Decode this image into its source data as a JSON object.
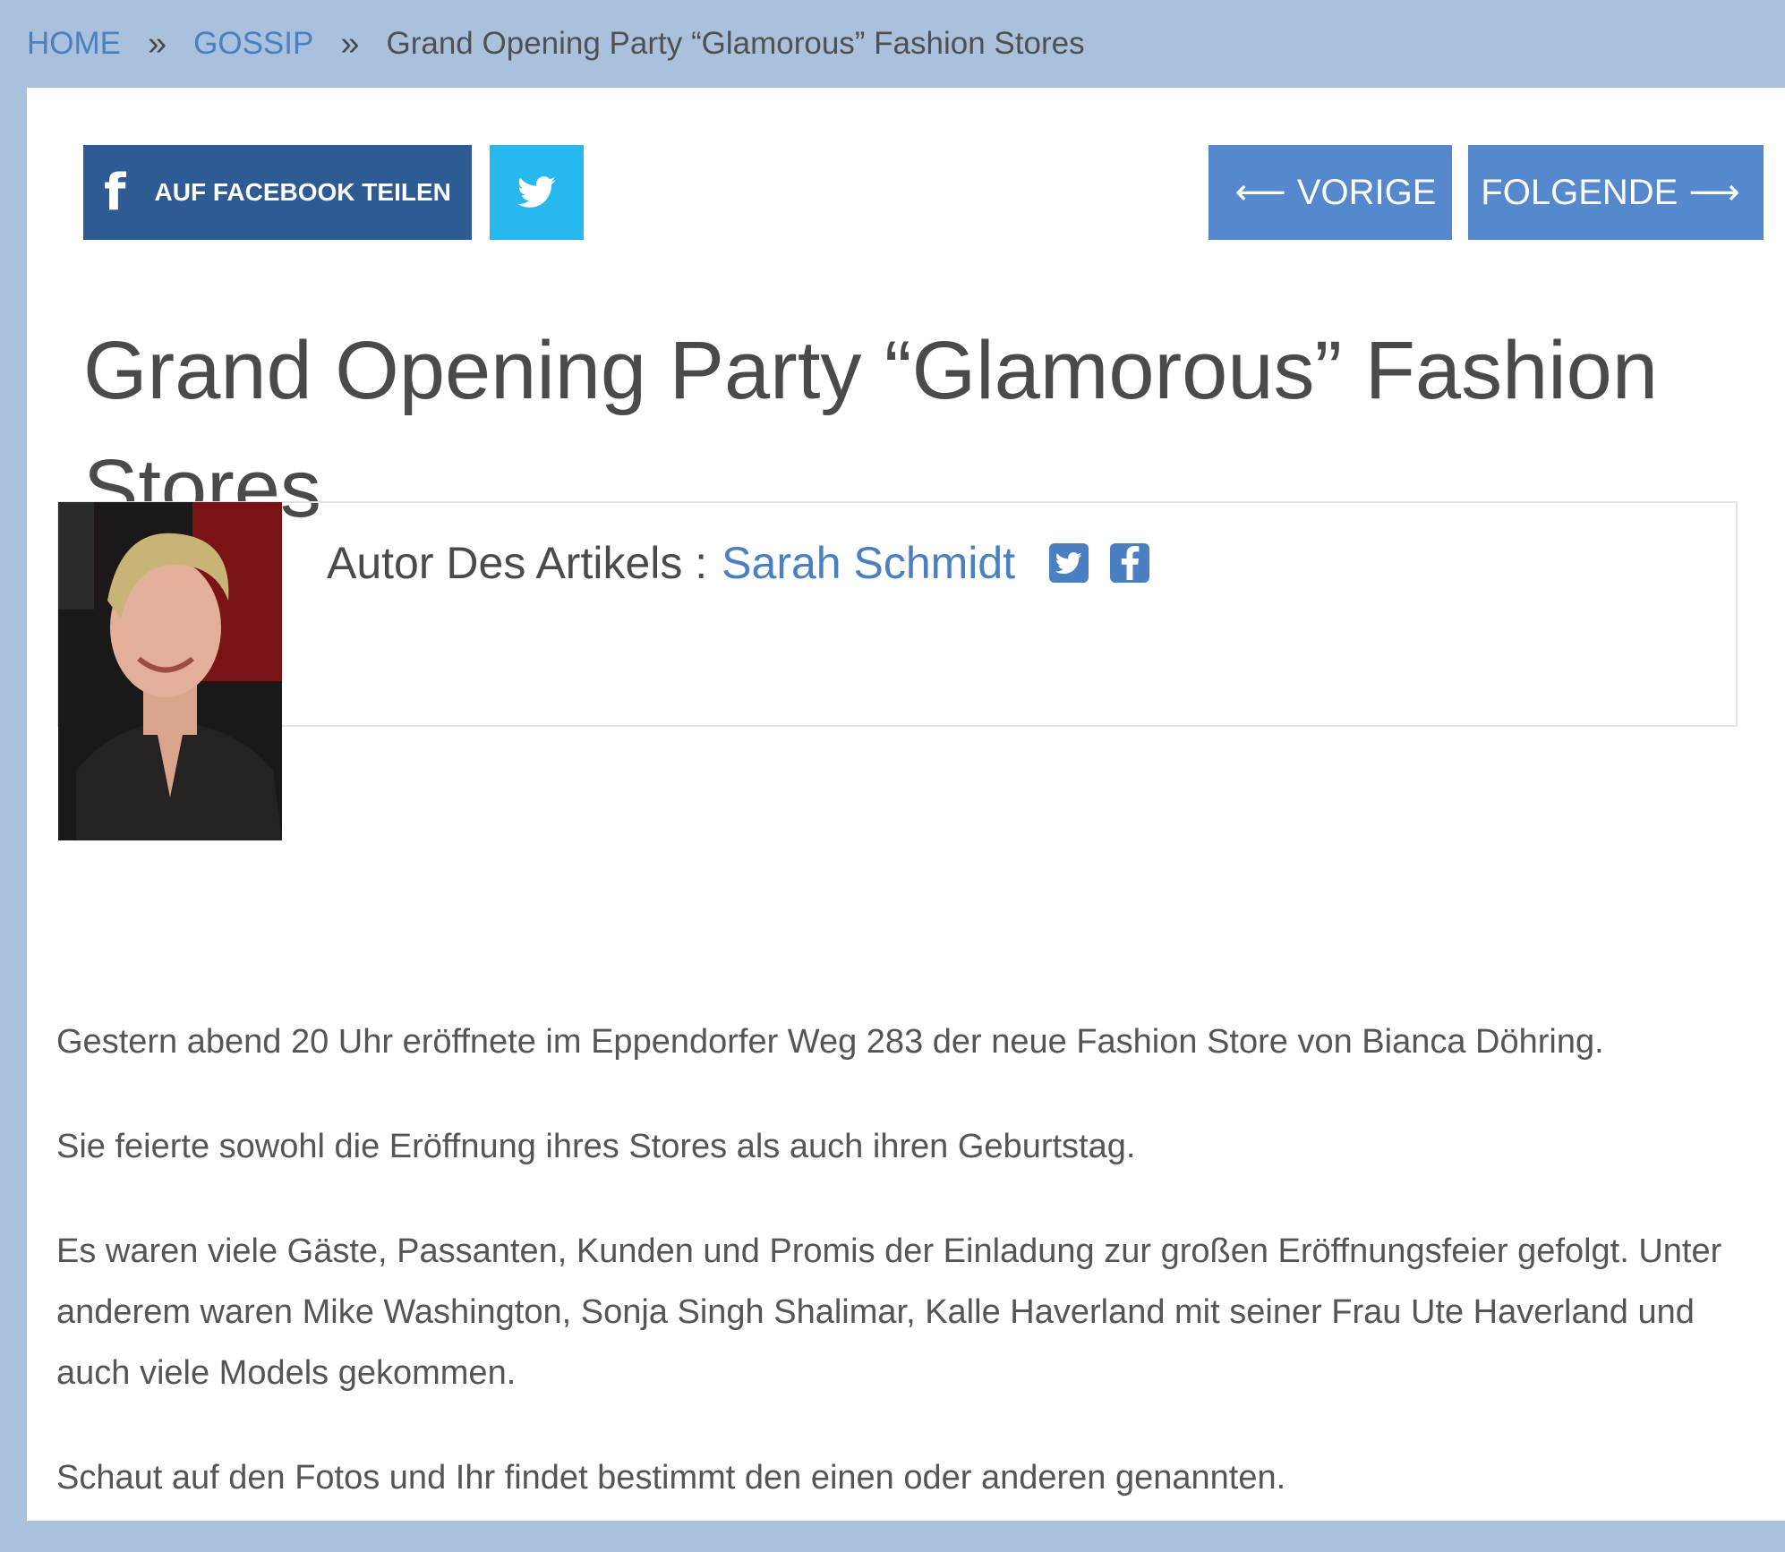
{
  "breadcrumb": {
    "home": "HOME",
    "category": "GOSSIP",
    "separator": "»",
    "current": "Grand Opening Party “Glamorous” Fashion Stores"
  },
  "share": {
    "facebook_label": "AUF FACEBOOK TEILEN",
    "facebook_icon": "facebook-f-icon",
    "twitter_icon": "twitter-bird-icon"
  },
  "nav": {
    "prev_label": "VORIGE",
    "next_label": "FOLGENDE",
    "prev_arrow": "⟵",
    "next_arrow": "⟶"
  },
  "article": {
    "title": "Grand Opening Party “Glamorous” Fashion Stores",
    "author_prefix": "Autor Des Artikels :",
    "author_name": "Sarah Schmidt",
    "paragraphs": [
      "Gestern abend 20 Uhr eröffnete im Eppendorfer Weg 283 der neue Fashion Store von Bianca Döhring.",
      "Sie feierte sowohl die Eröffnung ihres Stores als auch ihren Geburtstag.",
      "Es waren viele Gäste, Passanten, Kunden und Promis der Einladung zur großen Eröffnungsfeier gefolgt. Unter anderem waren Mike Washington, Sonja Singh Shalimar, Kalle Haverland mit seiner Frau Ute Haverland und auch viele Models gekommen.",
      "Schaut auf den Fotos und Ihr findet bestimmt den einen oder anderen genannten."
    ]
  },
  "colors": {
    "background": "#a9c1dc",
    "link": "#4a7fc1",
    "facebook": "#2e5b94",
    "twitter": "#27b8ef",
    "nav_button": "#5588cc"
  }
}
